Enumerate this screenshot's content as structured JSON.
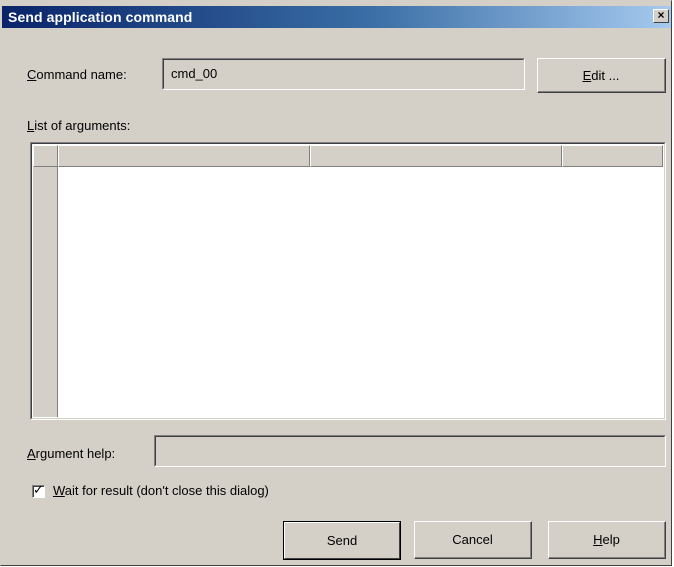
{
  "window": {
    "title": "Send application command",
    "close_glyph": "×"
  },
  "command": {
    "label_prefix": "C",
    "label_rest": "ommand name:",
    "value": "cmd_00",
    "edit_prefix": "E",
    "edit_rest": "dit ..."
  },
  "arguments": {
    "label_prefix": "L",
    "label_rest": "ist of arguments:",
    "columns": [
      "",
      "",
      ""
    ]
  },
  "argument_help": {
    "label_prefix": "A",
    "label_rest": "rgument help:",
    "value": ""
  },
  "wait_option": {
    "checked": true,
    "check_glyph": "✓",
    "label_prefix": "W",
    "label_rest": "ait for result (don't close this dialog)"
  },
  "buttons": {
    "send": "Send",
    "cancel": "Cancel",
    "help_prefix": "H",
    "help_rest": "elp"
  }
}
